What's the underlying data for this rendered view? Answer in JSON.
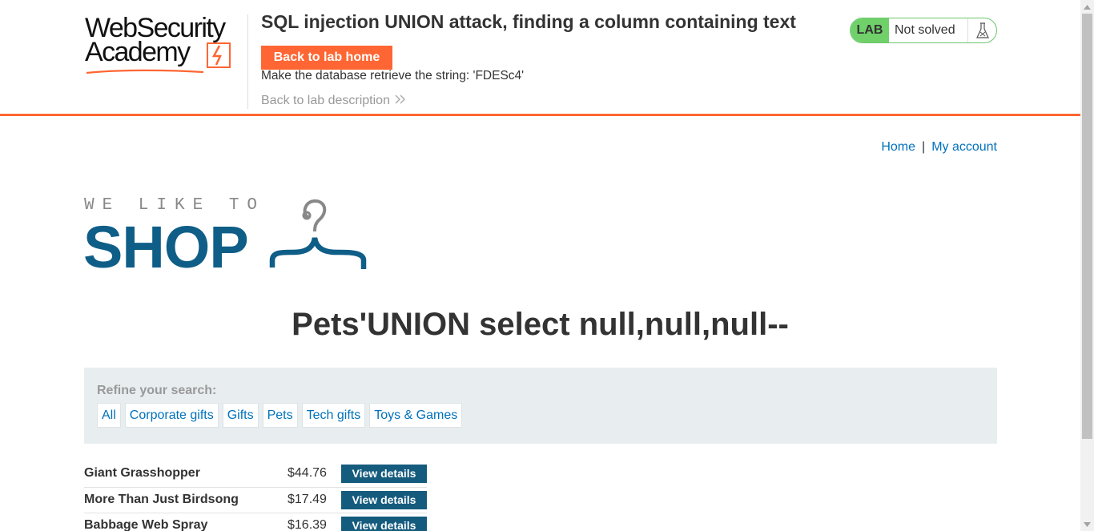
{
  "header": {
    "logo_line1": "WebSecurity",
    "logo_line2": "Academy",
    "lab_title": "SQL injection UNION attack, finding a column containing text",
    "back_home_label": "Back to lab home",
    "objective": "Make the database retrieve the string: 'FDESc4'",
    "back_description_label": "Back to lab description",
    "status_badge": "LAB",
    "status_text": "Not solved",
    "status_icon": "flask-icon"
  },
  "nav": {
    "home": "Home",
    "separator": "|",
    "account": "My account"
  },
  "shop_logo": {
    "small_text": "WE LIKE TO",
    "big_text": "SHOP",
    "icon": "hanger-icon"
  },
  "search_heading": "Pets'UNION select null,null,null--",
  "filter": {
    "label": "Refine your search:",
    "categories": [
      "All",
      "Corporate gifts",
      "Gifts",
      "Pets",
      "Tech gifts",
      "Toys & Games"
    ]
  },
  "products": [
    {
      "name": "Giant Grasshopper",
      "price": "$44.76",
      "button": "View details"
    },
    {
      "name": "More Than Just Birdsong",
      "price": "$17.49",
      "button": "View details"
    },
    {
      "name": "Babbage Web Spray",
      "price": "$16.39",
      "button": "View details"
    }
  ],
  "colors": {
    "accent_orange": "#ff6633",
    "brand_blue": "#0f5e87",
    "link_blue": "#0071bc",
    "status_green": "#70d16b"
  }
}
